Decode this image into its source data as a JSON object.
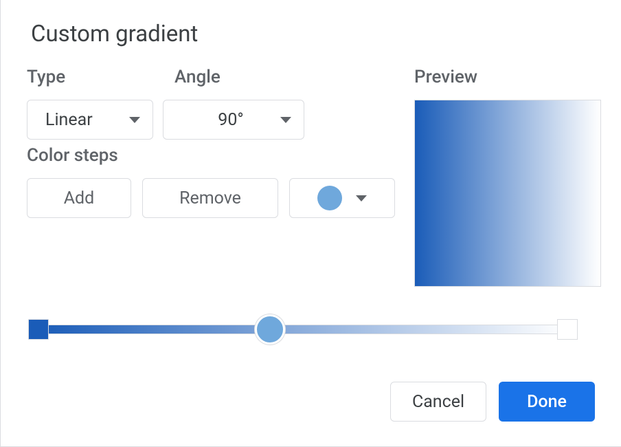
{
  "title": "Custom gradient",
  "labels": {
    "type": "Type",
    "angle": "Angle",
    "preview": "Preview",
    "color_steps": "Color steps"
  },
  "type_select": {
    "value": "Linear"
  },
  "angle_select": {
    "value": "90°"
  },
  "buttons": {
    "add": "Add",
    "remove": "Remove",
    "cancel": "Cancel",
    "done": "Done"
  },
  "colors": {
    "gradient_start": "#1a5cb8",
    "gradient_end": "#ffffff",
    "selected_step": "#6fa8dc",
    "primary": "#1a73e8"
  },
  "slider": {
    "thumb_position_pct": 44
  }
}
